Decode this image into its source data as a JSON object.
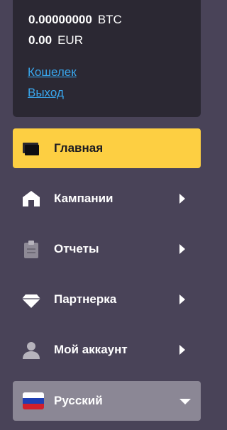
{
  "balance": {
    "btc_amount": "0.00000000",
    "btc_currency": "BTC",
    "eur_amount": "0.00",
    "eur_currency": "EUR",
    "links": {
      "wallet": "Кошелек",
      "logout": "Выход"
    }
  },
  "menu": {
    "items": [
      {
        "label": "Главная",
        "icon": "wallet-icon",
        "active": true
      },
      {
        "label": "Кампании",
        "icon": "home-icon",
        "active": false
      },
      {
        "label": "Отчеты",
        "icon": "clipboard-icon",
        "active": false
      },
      {
        "label": "Партнерка",
        "icon": "diamond-icon",
        "active": false
      },
      {
        "label": "Мой аккаунт",
        "icon": "user-icon",
        "active": false
      }
    ]
  },
  "language": {
    "selected": "Русский",
    "flag": "russia-flag-icon"
  },
  "colors": {
    "background": "#494358",
    "card": "#2b2833",
    "active": "#fdcf42",
    "link": "#39a7ee",
    "select": "#8b8795"
  }
}
